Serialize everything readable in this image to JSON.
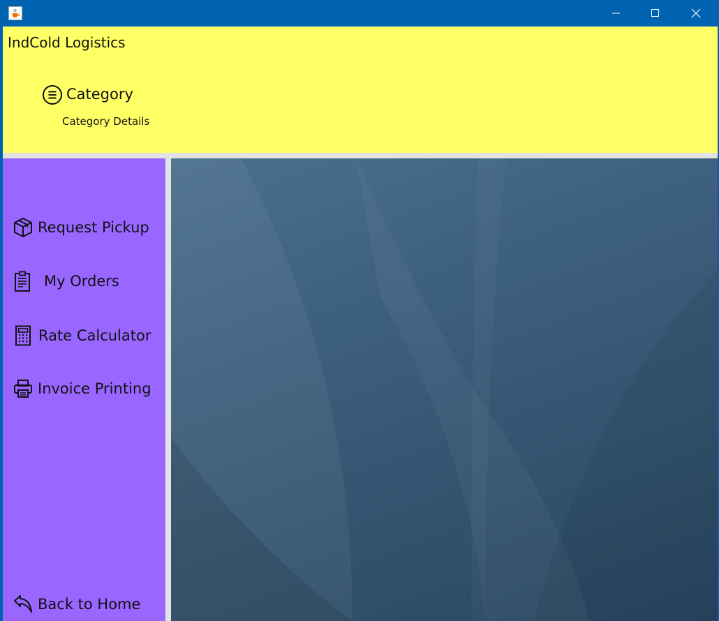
{
  "window": {
    "app_icon": "java-cup-icon",
    "controls": [
      "minimize-icon",
      "maximize-icon",
      "close-icon"
    ]
  },
  "header": {
    "app_title": "IndCold Logistics",
    "page_title": "Category",
    "page_subtitle": "Category Details",
    "page_icon": "list-circle-icon"
  },
  "sidebar": {
    "items": [
      {
        "label": "Request Pickup",
        "icon": "package-icon"
      },
      {
        "label": "My Orders",
        "icon": "clipboard-icon"
      },
      {
        "label": "Rate Calculator",
        "icon": "calculator-icon"
      },
      {
        "label": "Invoice Printing",
        "icon": "printer-icon"
      }
    ],
    "back": {
      "label": "Back to Home",
      "icon": "back-arrow-icon"
    }
  },
  "colors": {
    "titlebar": "#0063b1",
    "header_bg": "#ffff66",
    "sidebar_bg": "#9966ff",
    "content_bg": "#3d5f7e"
  }
}
